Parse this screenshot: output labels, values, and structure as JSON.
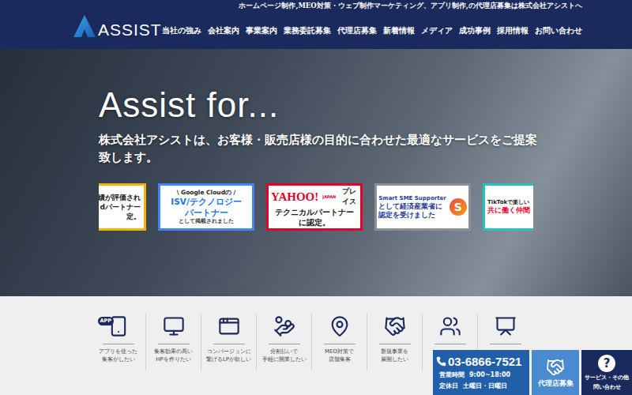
{
  "header": {
    "tagline": "ホームページ制作,MEO対策・ウェブ制作マーケティング、アプリ制作,の代理店募集は株式会社アシストへ",
    "logo": "ASSIST",
    "nav": [
      "当社の強み",
      "会社案内",
      "事業案内",
      "業務委託募集",
      "代理店募集",
      "新着情報",
      "メディア",
      "成功事例",
      "採用情報",
      "お問い合わせ"
    ]
  },
  "hero": {
    "title": "Assist for...",
    "subtitle": "株式会社アシストは、お客様・販売店様の目的に合わせた最適なサービスをご提案致します。",
    "banners": [
      {
        "kind": "award",
        "color": "#f2b400",
        "lines": [
          "績が評価され",
          "dパートナー",
          "定。"
        ]
      },
      {
        "kind": "google",
        "color": "#4285f4",
        "heading": "\\ Google Cloudの /",
        "lines": [
          "ISV/テクノロジー",
          "パートナー"
        ],
        "note": "として掲載されました"
      },
      {
        "kind": "yahoo",
        "color": "#e4002b",
        "heading": "YAHOO!",
        "sub": "JAPAN",
        "tag": "プレイス",
        "lines": [
          "テクニカルパートナー",
          "に認定。"
        ]
      },
      {
        "kind": "sme",
        "color": "#8a8f99",
        "heading": "Smart SME Supporter",
        "lines": [
          "として経済産業省に",
          "認定を受けました"
        ],
        "mark": "S"
      },
      {
        "kind": "tiktok",
        "color": "#25c2c2",
        "heading": "TikTokで楽しい",
        "lines": [
          "共に働く仲間"
        ]
      }
    ]
  },
  "services": [
    {
      "icon": "app",
      "icon_text": "APP",
      "lines": [
        "アプリを使った",
        "集客がしたい"
      ]
    },
    {
      "icon": "web",
      "lines": [
        "集客効果の高い",
        "HPを作りたい"
      ]
    },
    {
      "icon": "lp",
      "lines": [
        "コンバージョンに",
        "繋げるLPが欲しい"
      ]
    },
    {
      "icon": "payment",
      "lines": [
        "分割払いで",
        "手軽に開業したい"
      ]
    },
    {
      "icon": "meo",
      "lines": [
        "MEO対策で",
        "店舗集客"
      ]
    },
    {
      "icon": "business",
      "lines": [
        "新規事業を",
        "展開したい"
      ]
    },
    {
      "icon": "meeting",
      "lines": []
    },
    {
      "icon": "consult",
      "lines": []
    }
  ],
  "contact": {
    "phone": "03-6866-7521",
    "hours_label": "営業時間",
    "hours": "9:00~18:00",
    "closed_label": "定休日",
    "closed": "土曜日・日曜日",
    "agency": "代理店募集",
    "inquiry_mark": "?",
    "inquiry": [
      "サービス・その他",
      "問い合わせ"
    ]
  }
}
